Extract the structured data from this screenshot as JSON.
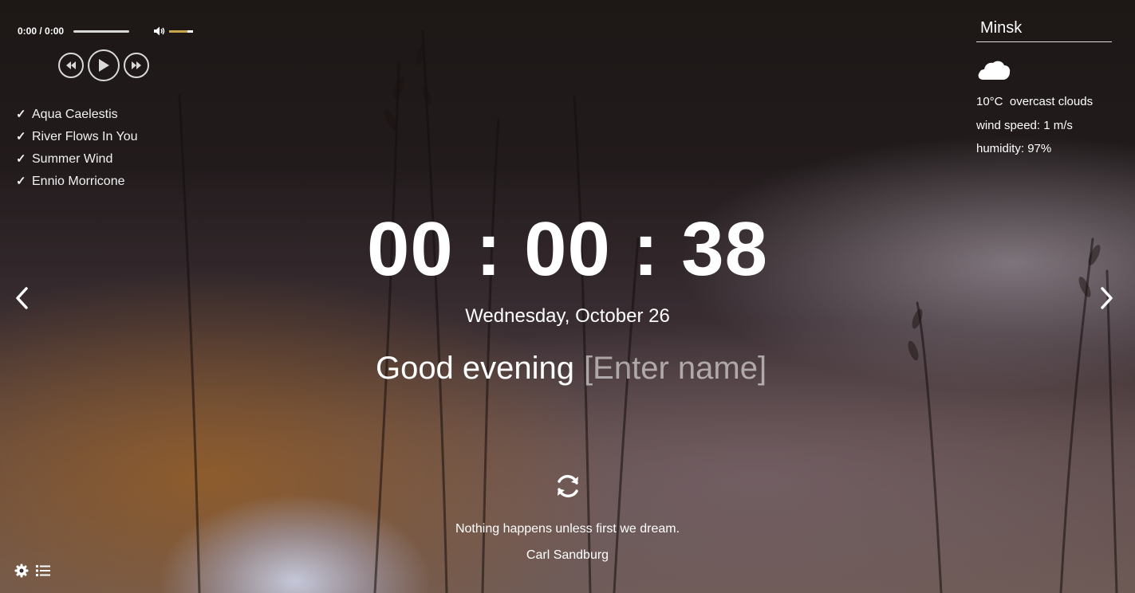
{
  "player": {
    "time": "0:00 / 0:00",
    "progress": 1.0,
    "volume": 0.75,
    "icons": {
      "volume": "volume-icon",
      "prev": "rewind-icon",
      "play": "play-icon",
      "next": "fast-forward-icon"
    },
    "playlist": [
      {
        "label": "Aqua Caelestis",
        "mark": "✓"
      },
      {
        "label": "River Flows In You",
        "mark": "✓"
      },
      {
        "label": "Summer Wind",
        "mark": "✓"
      },
      {
        "label": "Ennio Morricone",
        "mark": "✓"
      }
    ]
  },
  "weather": {
    "city": "Minsk",
    "icon": "cloud-icon",
    "temperature": "10°C",
    "description": "overcast clouds",
    "wind": "wind speed: 1 m/s",
    "humidity": "humidity: 97%"
  },
  "clock": {
    "time": "00 : 00 : 38"
  },
  "date": "Wednesday, October 26",
  "greeting": {
    "text": "Good evening",
    "name_placeholder": "[Enter name]"
  },
  "quote": {
    "text": "Nothing happens unless first we dream.",
    "author": "Carl Sandburg"
  },
  "colors": {
    "volume_fill": "#c9a64d",
    "text": "#ffffff"
  }
}
